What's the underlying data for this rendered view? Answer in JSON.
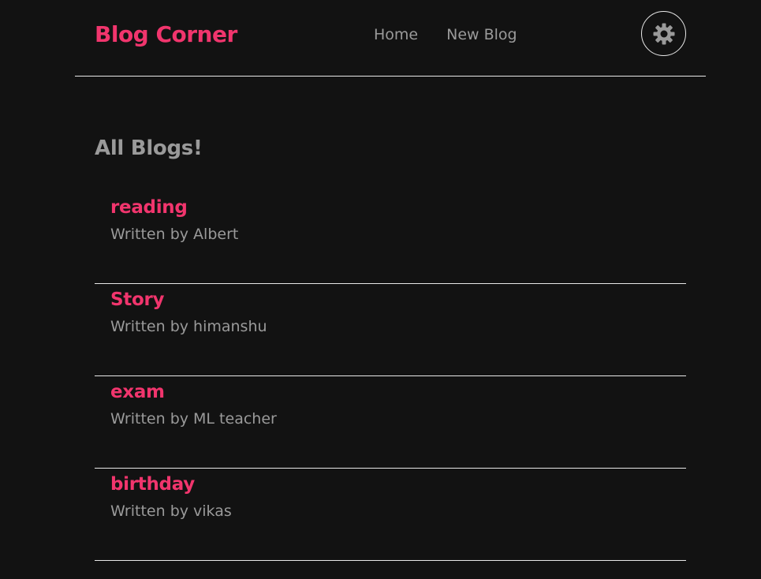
{
  "navbar": {
    "brand": "Blog Corner",
    "links": [
      {
        "label": "Home"
      },
      {
        "label": "New Blog"
      }
    ],
    "theme_toggle_icon": "gear-icon"
  },
  "main": {
    "heading": "All Blogs!",
    "blogs": [
      {
        "title": "reading",
        "author_line": "Written by Albert"
      },
      {
        "title": "Story",
        "author_line": "Written by himanshu"
      },
      {
        "title": "exam",
        "author_line": "Written by ML teacher"
      },
      {
        "title": "birthday",
        "author_line": "Written by vikas"
      }
    ]
  },
  "colors": {
    "background": "#121212",
    "accent": "#f1356d",
    "muted_text": "#9a9a9a",
    "divider": "#e8e8e8"
  }
}
